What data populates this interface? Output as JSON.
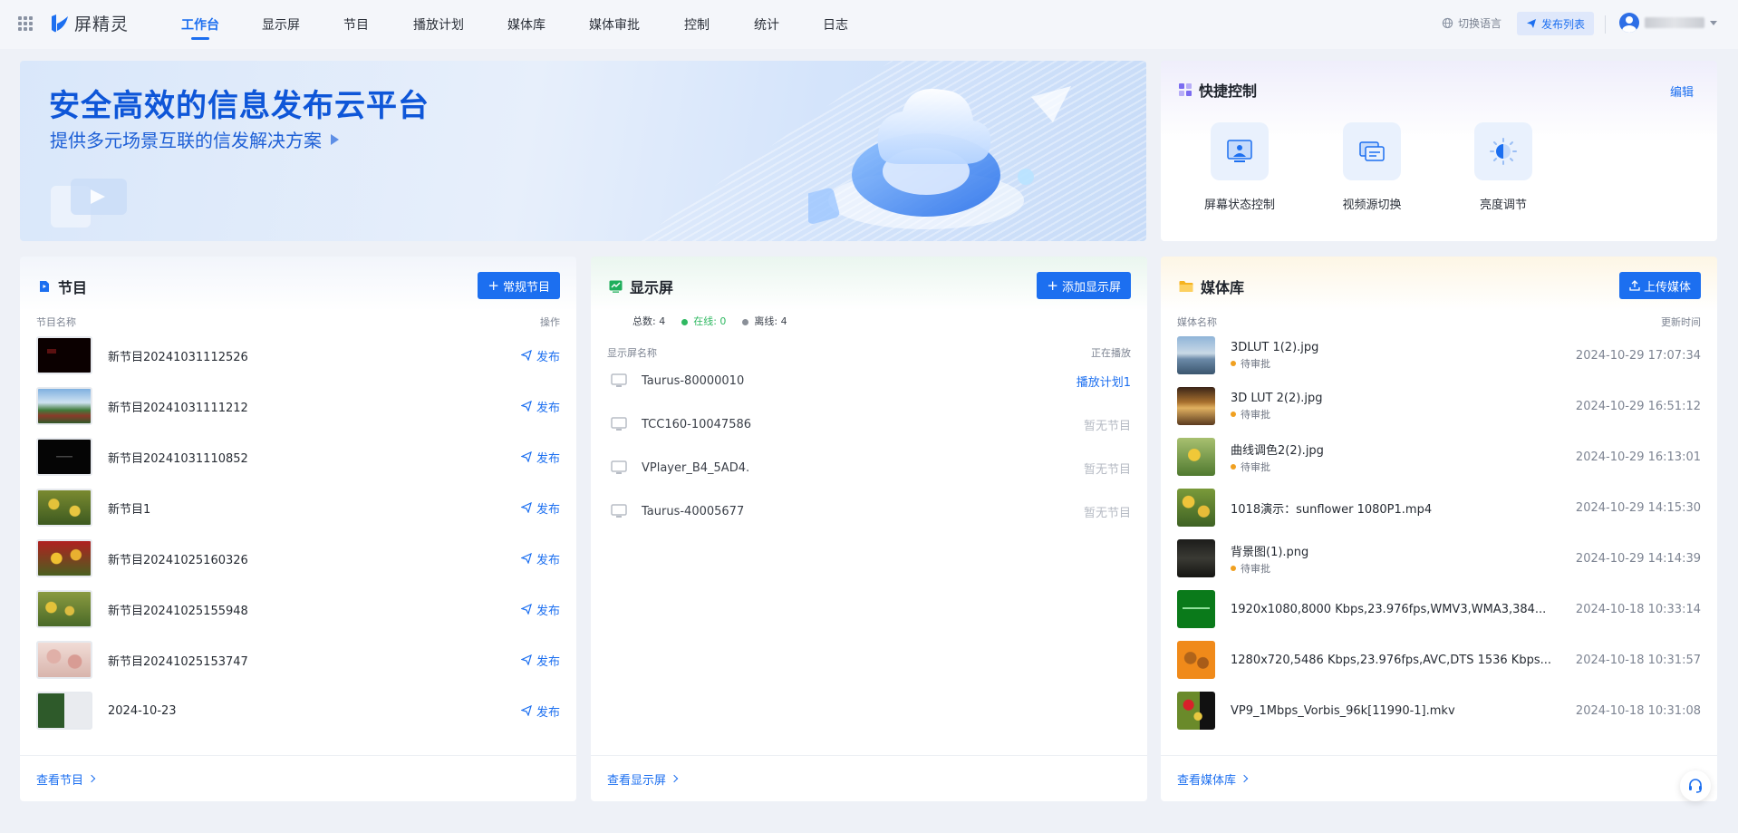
{
  "brand": {
    "name": "屏精灵"
  },
  "nav": [
    "工作台",
    "显示屏",
    "节目",
    "播放计划",
    "媒体库",
    "媒体审批",
    "控制",
    "统计",
    "日志"
  ],
  "header": {
    "lang_label": "切换语言",
    "publish_list_label": "发布列表"
  },
  "banner": {
    "title": "安全高效的信息发布云平台",
    "subtitle": "提供多元场景互联的信发解决方案"
  },
  "quick": {
    "title": "快捷控制",
    "edit_label": "编辑",
    "items": [
      "屏幕状态控制",
      "视频源切换",
      "亮度调节"
    ]
  },
  "programs": {
    "title": "节目",
    "button": "常规节目",
    "col_name": "节目名称",
    "col_action": "操作",
    "publish_label": "发布",
    "footer": "查看节目",
    "items": [
      "新节目20241031112526",
      "新节目20241031111212",
      "新节目20241031110852",
      "新节目1",
      "新节目20241025160326",
      "新节目20241025155948",
      "新节目20241025153747",
      "2024-10-23"
    ]
  },
  "screens": {
    "title": "显示屏",
    "button": "添加显示屏",
    "stats": {
      "total": "总数: 4",
      "online": "在线: 0",
      "offline": "离线: 4"
    },
    "col_name": "显示屏名称",
    "col_playing": "正在播放",
    "footer": "查看显示屏",
    "items": [
      {
        "name": "Taurus-80000010",
        "playing": "播放计划1"
      },
      {
        "name": "TCC160-10047586",
        "playing": "暂无节目"
      },
      {
        "name": "VPlayer_B4_5AD4.",
        "playing": "暂无节目"
      },
      {
        "name": "Taurus-40005677",
        "playing": "暂无节目"
      }
    ]
  },
  "media": {
    "title": "媒体库",
    "button": "上传媒体",
    "col_name": "媒体名称",
    "col_time": "更新时间",
    "footer": "查看媒体库",
    "items": [
      {
        "name": "3DLUT 1(2).jpg",
        "status": "待审批",
        "time": "2024-10-29 17:07:34"
      },
      {
        "name": "3D LUT 2(2).jpg",
        "status": "待审批",
        "time": "2024-10-29 16:51:12"
      },
      {
        "name": "曲线调色2(2).jpg",
        "status": "待审批",
        "time": "2024-10-29 16:13:01"
      },
      {
        "name": "1018演示：sunflower 1080P1.mp4",
        "status": "",
        "time": "2024-10-29 14:15:30"
      },
      {
        "name": "背景图(1).png",
        "status": "待审批",
        "time": "2024-10-29 14:14:39"
      },
      {
        "name": "1920x1080,8000 Kbps,23.976fps,WMV3,WMA3,384...",
        "status": "",
        "time": "2024-10-18 10:33:14"
      },
      {
        "name": "1280x720,5486 Kbps,23.976fps,AVC,DTS 1536 Kbps...",
        "status": "",
        "time": "2024-10-18 10:31:57"
      },
      {
        "name": "VP9_1Mbps_Vorbis_96k[11990-1].mkv",
        "status": "",
        "time": "2024-10-18 10:31:08"
      }
    ]
  },
  "colors": {
    "accent": "#1c6ff0",
    "online": "#2fb861",
    "offline": "#8a8f98",
    "pending": "#f0a020"
  }
}
